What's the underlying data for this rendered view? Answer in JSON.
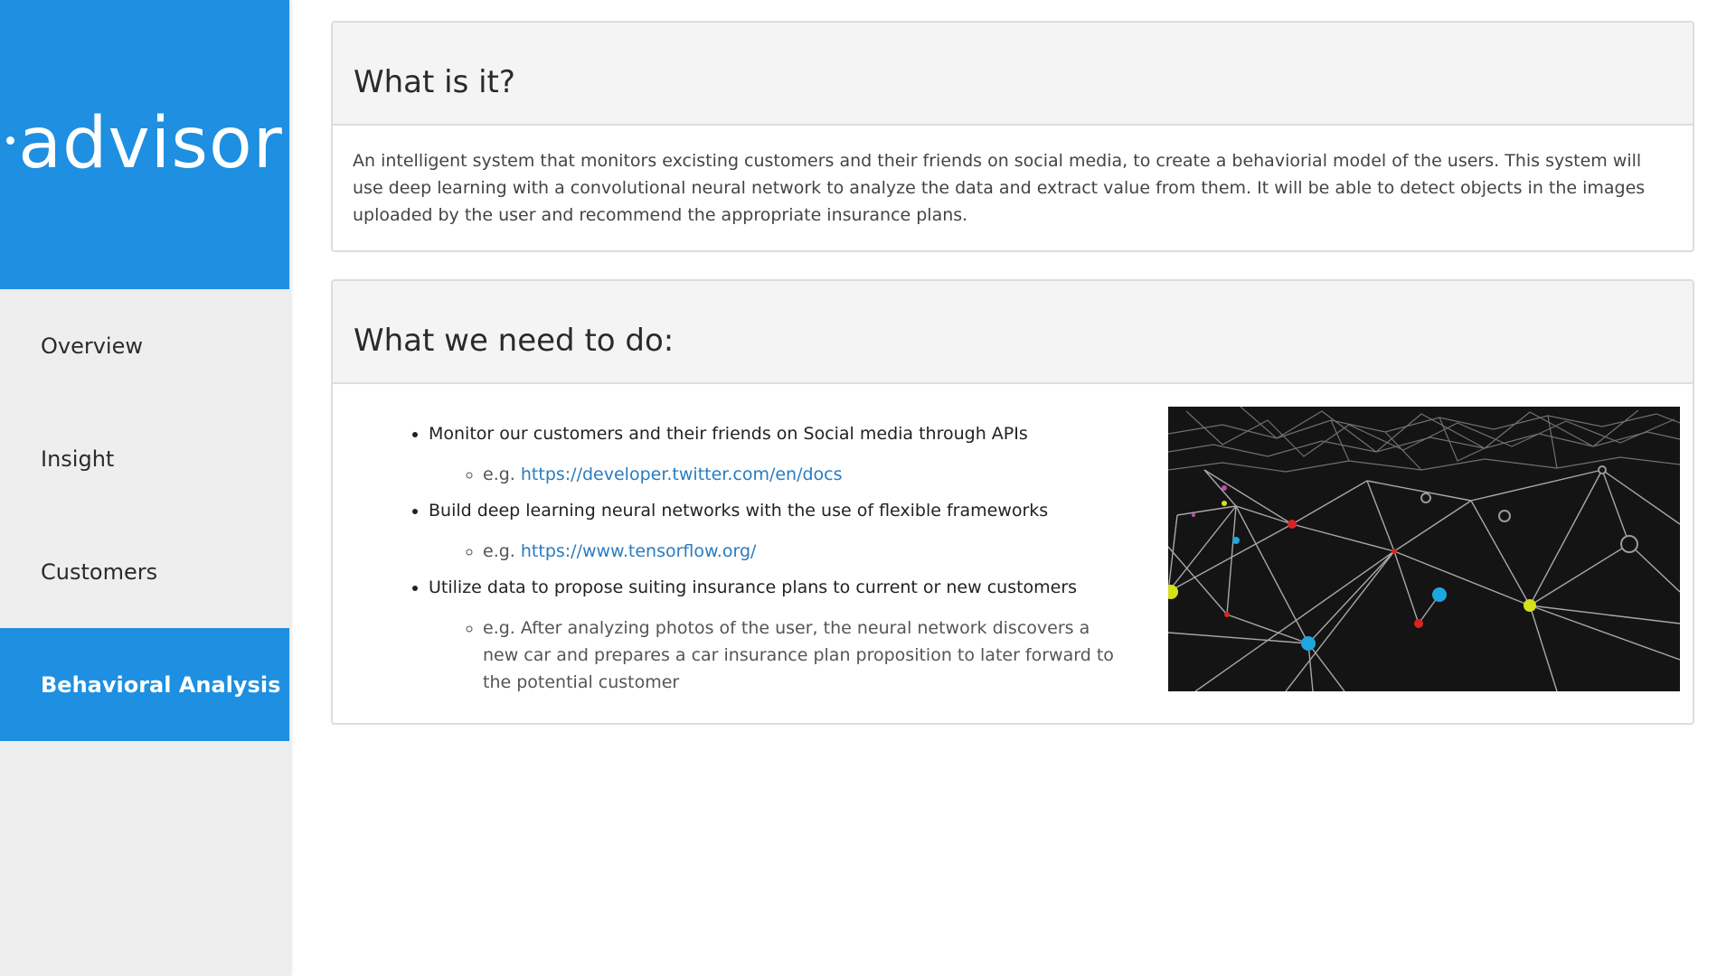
{
  "brand": {
    "logo_text": "advisor",
    "color": "#1e8fe1"
  },
  "nav": {
    "items": [
      {
        "label": "Overview",
        "active": false
      },
      {
        "label": "Insight",
        "active": false
      },
      {
        "label": "Customers",
        "active": false
      },
      {
        "label": "Behavioral Analysis",
        "active": true
      }
    ]
  },
  "sections": {
    "what_is_it": {
      "title": "What is it?",
      "body": "An intelligent system that monitors excisting customers and their friends on social media, to create a behaviorial model of the users. This system will use deep learning with a convolutional neural network to analyze the data and extract value from them. It will be able to detect objects in the images uploaded by the user and recommend the appropriate insurance plans."
    },
    "what_we_need": {
      "title": "What we need to do:",
      "items": [
        {
          "text": "Monitor our customers and their friends on Social media through APIs",
          "sub_prefix": "e.g. ",
          "sub_link": "https://developer.twitter.com/en/docs"
        },
        {
          "text": "Build deep learning neural networks with the use of flexible frameworks",
          "sub_prefix": "e.g. ",
          "sub_link": "https://www.tensorflow.org/"
        },
        {
          "text": "Utilize data to propose suiting insurance plans to current or new customers",
          "sub_text": "e.g. After analyzing photos of the user, the neural network discovers a new car and prepares a car insurance plan proposition to later forward to the potential customer"
        }
      ],
      "image": {
        "icon": "neural-network-image",
        "background": "#141414",
        "node_colors": [
          "#d4e11a",
          "#1ea7de",
          "#d8251f",
          "#c24ab0"
        ]
      }
    }
  }
}
